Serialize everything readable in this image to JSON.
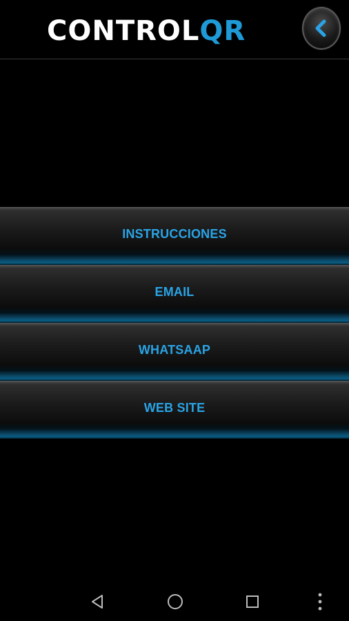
{
  "header": {
    "logo_part1": "CONTROL",
    "logo_part2": "QR",
    "back_icon": "chevron-left-icon"
  },
  "menu": {
    "items": [
      {
        "label": "INSTRUCCIONES"
      },
      {
        "label": "EMAIL"
      },
      {
        "label": "WHATSAAP"
      },
      {
        "label": "WEB SITE"
      }
    ]
  },
  "navbar": {
    "icons": [
      "back-triangle-icon",
      "home-circle-icon",
      "recents-square-icon",
      "more-vert-icon"
    ]
  },
  "colors": {
    "background": "#000000",
    "accent": "#2aa4e6",
    "logo_white": "#ffffff",
    "logo_blue": "#1e9ad6"
  }
}
